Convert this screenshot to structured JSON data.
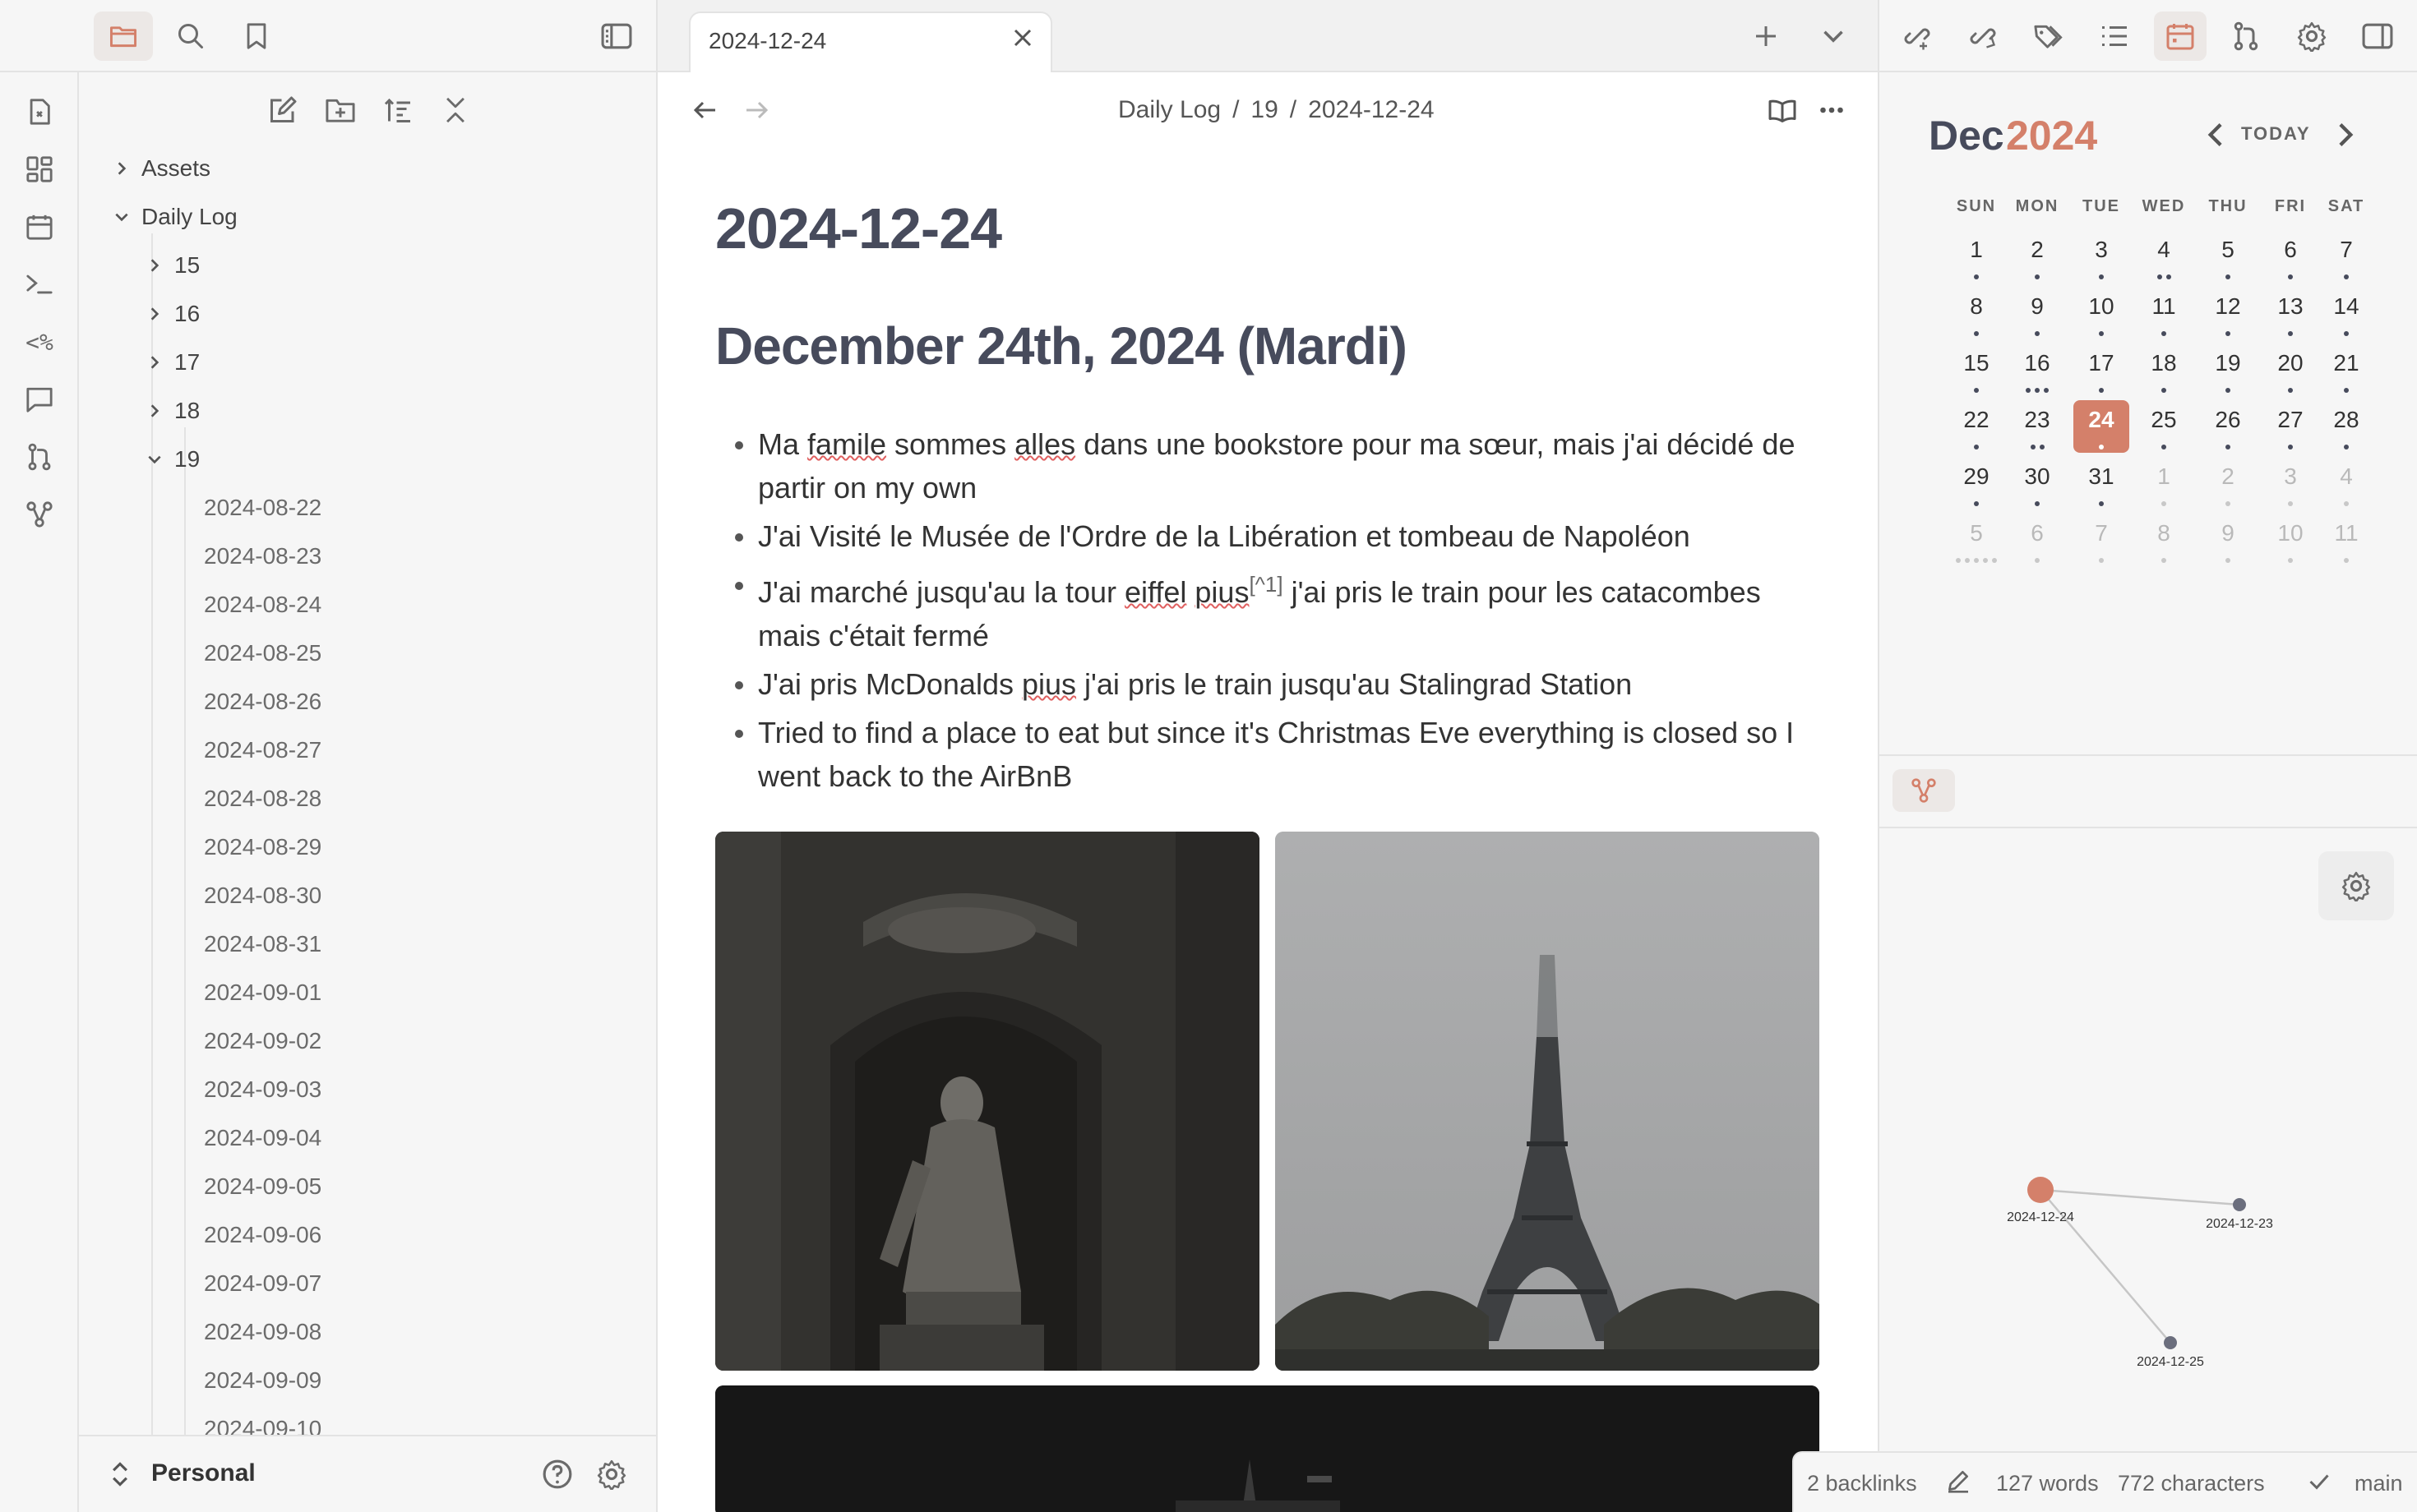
{
  "tab": {
    "title": "2024-12-24"
  },
  "breadcrumb": {
    "part1": "Daily Log",
    "sep1": "/",
    "part2": "19",
    "sep2": "/",
    "part3": "2024-12-24"
  },
  "note": {
    "title": "2024-12-24",
    "heading": "December 24th, 2024 (Mardi)",
    "bullets": {
      "b1": {
        "a": "Ma ",
        "b": "famile",
        "c": " sommes ",
        "d": "alles",
        "e": " dans une bookstore pour ma sœur, mais j'ai décidé de partir on my own"
      },
      "b2": "J'ai Visité le Musée de l'Ordre de la Libération et tombeau de Napoléon",
      "b3": {
        "a": "J'ai marché jusqu'au la tour ",
        "b": "eiffel",
        "c": " ",
        "d": "pius",
        "e": "[^1]",
        "f": " j'ai pris le train pour les catacombes mais c'était fermé"
      },
      "b4": {
        "a": "J'ai pris McDonalds ",
        "b": "pius",
        "c": " j'ai pris le train jusqu'au Stalingrad Station"
      },
      "b5": "Tried to find a place to eat but since it's Christmas Eve everything is closed so I went back to the AirBnB"
    }
  },
  "explorer": {
    "folders": [
      "Assets",
      "Daily Log",
      "15",
      "16",
      "17",
      "18",
      "19"
    ],
    "files": [
      "2024-08-22",
      "2024-08-23",
      "2024-08-24",
      "2024-08-25",
      "2024-08-26",
      "2024-08-27",
      "2024-08-28",
      "2024-08-29",
      "2024-08-30",
      "2024-08-31",
      "2024-09-01",
      "2024-09-02",
      "2024-09-03",
      "2024-09-04",
      "2024-09-05",
      "2024-09-06",
      "2024-09-07",
      "2024-09-08",
      "2024-09-09",
      "2024-09-10"
    ]
  },
  "vault": {
    "name": "Personal"
  },
  "calendar": {
    "month": "Dec",
    "year": "2024",
    "today_label": "TODAY",
    "weekdays": [
      "SUN",
      "MON",
      "TUE",
      "WED",
      "THU",
      "FRI",
      "SAT"
    ],
    "weeks": [
      [
        {
          "d": "1",
          "dots": 1,
          "o": false
        },
        {
          "d": "2",
          "dots": 1,
          "o": false
        },
        {
          "d": "3",
          "dots": 1,
          "o": false
        },
        {
          "d": "4",
          "dots": 2,
          "o": false
        },
        {
          "d": "5",
          "dots": 1,
          "o": false
        },
        {
          "d": "6",
          "dots": 1,
          "o": false
        },
        {
          "d": "7",
          "dots": 1,
          "o": false
        }
      ],
      [
        {
          "d": "8",
          "dots": 1,
          "o": false
        },
        {
          "d": "9",
          "dots": 1,
          "o": false
        },
        {
          "d": "10",
          "dots": 1,
          "o": false
        },
        {
          "d": "11",
          "dots": 1,
          "o": false
        },
        {
          "d": "12",
          "dots": 1,
          "o": false
        },
        {
          "d": "13",
          "dots": 1,
          "o": false
        },
        {
          "d": "14",
          "dots": 1,
          "o": false
        }
      ],
      [
        {
          "d": "15",
          "dots": 1,
          "o": false
        },
        {
          "d": "16",
          "dots": 3,
          "o": false
        },
        {
          "d": "17",
          "dots": 1,
          "o": false
        },
        {
          "d": "18",
          "dots": 1,
          "o": false
        },
        {
          "d": "19",
          "dots": 1,
          "o": false
        },
        {
          "d": "20",
          "dots": 1,
          "o": false
        },
        {
          "d": "21",
          "dots": 1,
          "o": false
        }
      ],
      [
        {
          "d": "22",
          "dots": 1,
          "o": false
        },
        {
          "d": "23",
          "dots": 2,
          "o": false
        },
        {
          "d": "24",
          "dots": 1,
          "o": false,
          "today": true
        },
        {
          "d": "25",
          "dots": 1,
          "o": false
        },
        {
          "d": "26",
          "dots": 1,
          "o": false
        },
        {
          "d": "27",
          "dots": 1,
          "o": false
        },
        {
          "d": "28",
          "dots": 1,
          "o": false
        }
      ],
      [
        {
          "d": "29",
          "dots": 1,
          "o": false
        },
        {
          "d": "30",
          "dots": 1,
          "o": false
        },
        {
          "d": "31",
          "dots": 1,
          "o": false
        },
        {
          "d": "1",
          "dots": 1,
          "o": true
        },
        {
          "d": "2",
          "dots": 1,
          "o": true
        },
        {
          "d": "3",
          "dots": 1,
          "o": true
        },
        {
          "d": "4",
          "dots": 1,
          "o": true
        }
      ],
      [
        {
          "d": "5",
          "dots": 5,
          "o": true
        },
        {
          "d": "6",
          "dots": 1,
          "o": true
        },
        {
          "d": "7",
          "dots": 1,
          "o": true
        },
        {
          "d": "8",
          "dots": 1,
          "o": true
        },
        {
          "d": "9",
          "dots": 1,
          "o": true
        },
        {
          "d": "10",
          "dots": 1,
          "o": true
        },
        {
          "d": "11",
          "dots": 1,
          "o": true
        }
      ]
    ]
  },
  "graph": {
    "nodes": [
      {
        "label": "2024-12-24",
        "current": true
      },
      {
        "label": "2024-12-23",
        "current": false
      },
      {
        "label": "2024-12-25",
        "current": false
      }
    ]
  },
  "status": {
    "backlinks": "2 backlinks",
    "words": "127 words",
    "characters": "772 characters",
    "branch": "main"
  },
  "colors": {
    "accent": "#d4806a",
    "text": "#474b5c",
    "today_bg": "#d4806a"
  },
  "icons": {
    "ribbon": [
      "open-note-icon",
      "canvas-icon",
      "daily-note-icon",
      "terminal-icon",
      "templater-icon",
      "chat-icon",
      "git-icon",
      "graph-icon"
    ],
    "top_left": [
      "folder-icon",
      "search-icon",
      "bookmark-icon",
      "sidebar-toggle-icon"
    ],
    "right_top": [
      "backlinks-icon",
      "outgoing-links-icon",
      "tags-icon",
      "outline-icon",
      "calendar-icon",
      "git-source-icon",
      "settings-icon",
      "right-sidebar-icon"
    ]
  }
}
